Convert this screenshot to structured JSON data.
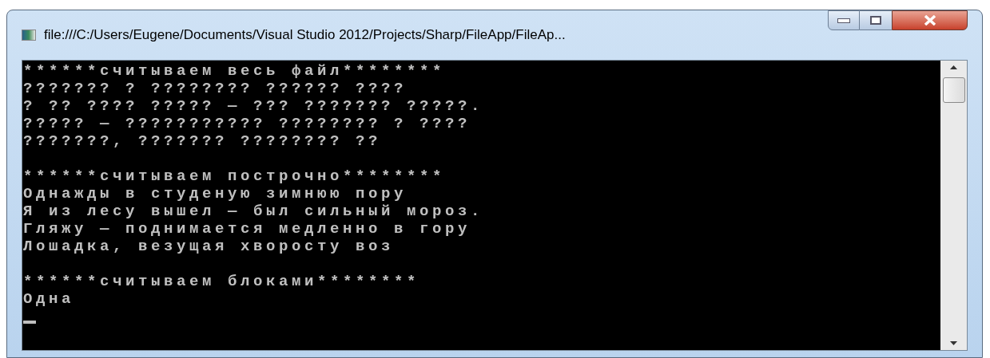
{
  "window": {
    "title": "file:///C:/Users/Eugene/Documents/Visual Studio 2012/Projects/Sharp/FileApp/FileAp..."
  },
  "console": {
    "lines": [
      {
        "kind": "text",
        "text": "******считываем весь файл********"
      },
      {
        "kind": "text",
        "text": "??????? ? ???????? ?????? ????"
      },
      {
        "kind": "text",
        "text": "? ?? ???? ????? — ??? ??????? ?????."
      },
      {
        "kind": "text",
        "text": "????? — ??????????? ???????? ? ????"
      },
      {
        "kind": "text",
        "text": "???????, ??????? ???????? ??"
      },
      {
        "kind": "blank"
      },
      {
        "kind": "text",
        "text": "******считываем построчно********"
      },
      {
        "kind": "text",
        "text": "Однажды в студеную зимнюю пору"
      },
      {
        "kind": "text",
        "text": "Я из лесу вышел — был сильный мороз."
      },
      {
        "kind": "text",
        "text": "Гляжу — поднимается медленно в гору"
      },
      {
        "kind": "text",
        "text": "Лошадка, везущая хворосту воз"
      },
      {
        "kind": "blank"
      },
      {
        "kind": "text",
        "text": "******считываем блоками********"
      },
      {
        "kind": "text",
        "text": "Одна"
      },
      {
        "kind": "cursor"
      }
    ]
  }
}
